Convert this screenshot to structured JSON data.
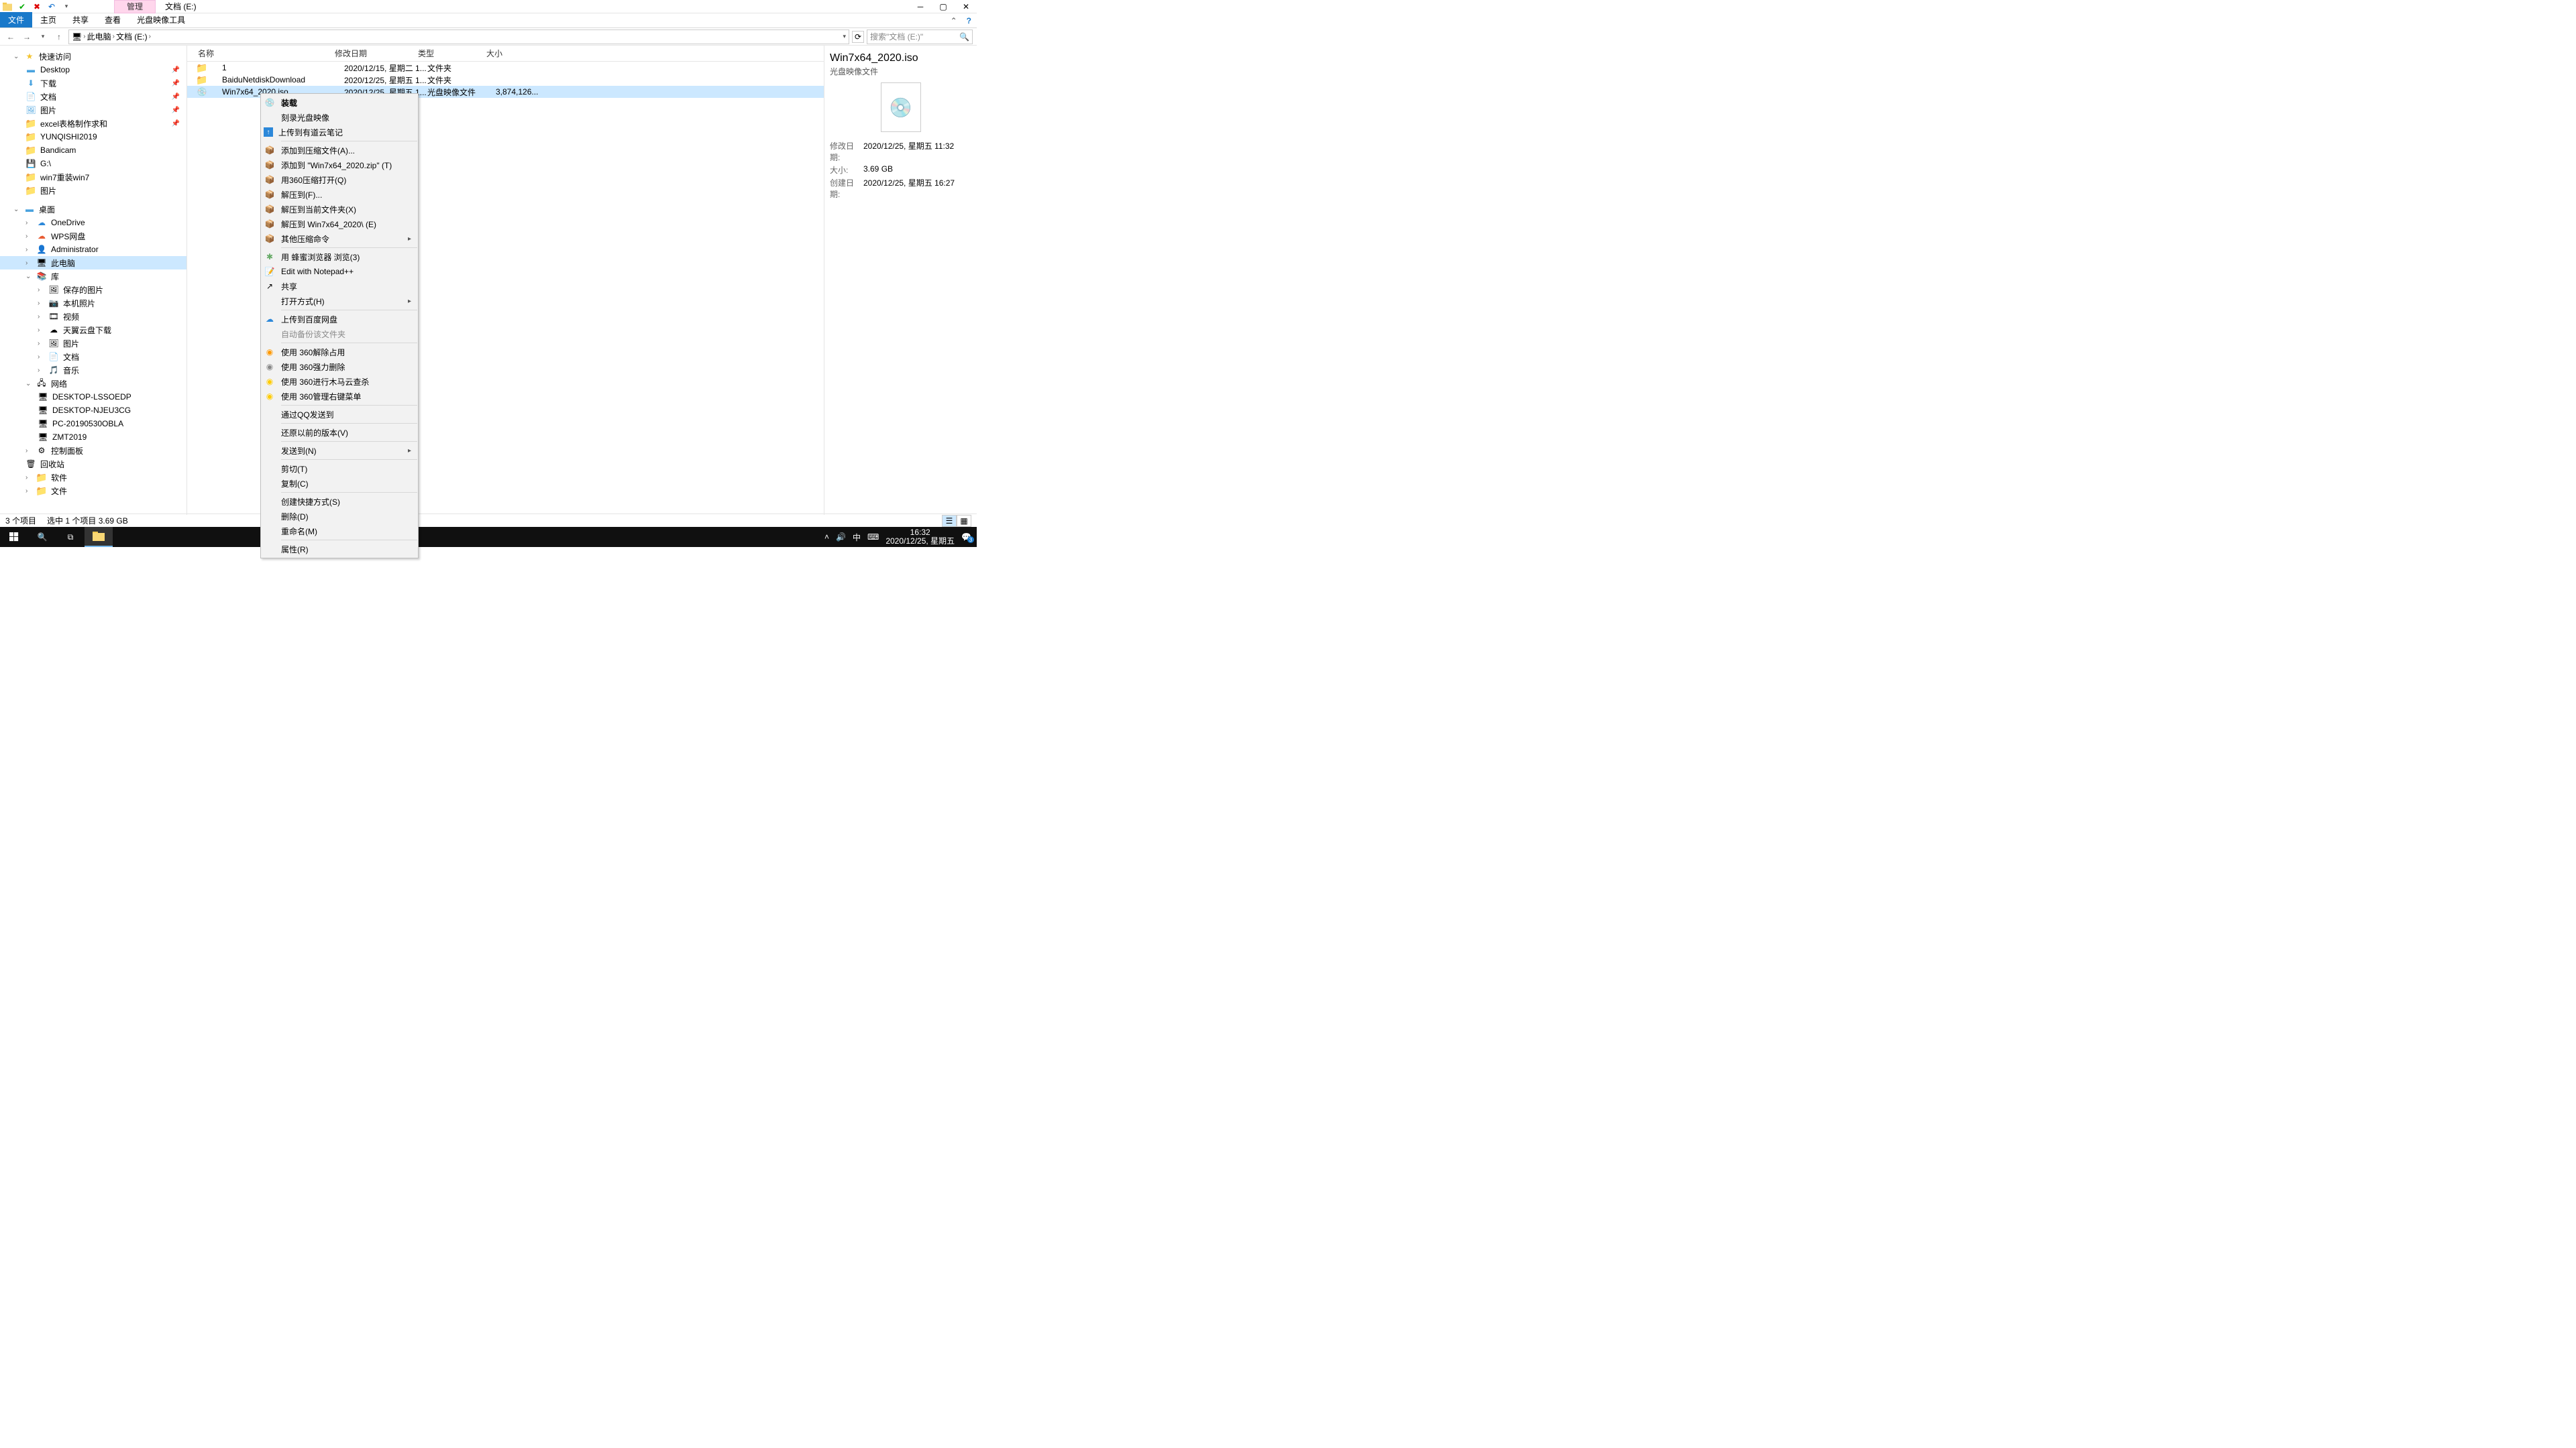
{
  "title_tab_manage": "管理",
  "title_tab_path": "文档 (E:)",
  "ribbon": {
    "file": "文件",
    "home": "主页",
    "share": "共享",
    "view": "查看",
    "tool": "光盘映像工具"
  },
  "breadcrumb": {
    "pc": "此电脑",
    "drive": "文档 (E:)"
  },
  "search_placeholder": "搜索\"文档 (E:)\"",
  "sidebar": {
    "quick": "快速访问",
    "items_qa": [
      "Desktop",
      "下载",
      "文档",
      "图片",
      "excel表格制作求和",
      "YUNQISHI2019",
      "Bandicam",
      "G:\\",
      "win7重装win7",
      "图片"
    ],
    "desktop": "桌面",
    "items_dt": [
      "OneDrive",
      "WPS网盘",
      "Administrator",
      "此电脑",
      "库"
    ],
    "items_lib": [
      "保存的图片",
      "本机照片",
      "视频",
      "天翼云盘下载",
      "图片",
      "文档",
      "音乐"
    ],
    "network": "网络",
    "items_net": [
      "DESKTOP-LSSOEDP",
      "DESKTOP-NJEU3CG",
      "PC-20190530OBLA",
      "ZMT2019"
    ],
    "items_misc": [
      "控制面板",
      "回收站",
      "软件",
      "文件"
    ]
  },
  "cols": {
    "name": "名称",
    "date": "修改日期",
    "type": "类型",
    "size": "大小"
  },
  "rows": [
    {
      "name": "1",
      "date": "2020/12/15, 星期二 1...",
      "type": "文件夹",
      "size": ""
    },
    {
      "name": "BaiduNetdiskDownload",
      "date": "2020/12/25, 星期五 1...",
      "type": "文件夹",
      "size": ""
    },
    {
      "name": "Win7x64_2020.iso",
      "date": "2020/12/25, 星期五 1...",
      "type": "光盘映像文件",
      "size": "3,874,126..."
    }
  ],
  "ctx": {
    "mount": "装载",
    "burn": "刻录光盘映像",
    "youdao": "上传到有道云笔记",
    "add_archive": "添加到压缩文件(A)...",
    "add_zip": "添加到 \"Win7x64_2020.zip\" (T)",
    "open_360zip": "用360压缩打开(Q)",
    "extract_to": "解压到(F)...",
    "extract_here": "解压到当前文件夹(X)",
    "extract_named": "解压到 Win7x64_2020\\ (E)",
    "other_zip": "其他压缩命令",
    "bee": "用 蜂蜜浏览器 浏览(3)",
    "npp": "Edit with Notepad++",
    "share": "共享",
    "openwith": "打开方式(H)",
    "baidu": "上传到百度网盘",
    "autobak": "自动备份该文件夹",
    "s360_unlock": "使用 360解除占用",
    "s360_delete": "使用 360强力删除",
    "s360_scan": "使用 360进行木马云查杀",
    "s360_menu": "使用 360管理右键菜单",
    "qq": "通过QQ发送到",
    "restore": "还原以前的版本(V)",
    "sendto": "发送到(N)",
    "cut": "剪切(T)",
    "copy": "复制(C)",
    "shortcut": "创建快捷方式(S)",
    "delete": "删除(D)",
    "rename": "重命名(M)",
    "props": "属性(R)"
  },
  "details": {
    "title": "Win7x64_2020.iso",
    "sub": "光盘映像文件",
    "mod_lbl": "修改日期:",
    "mod_val": "2020/12/25, 星期五 11:32",
    "size_lbl": "大小:",
    "size_val": "3.69 GB",
    "create_lbl": "创建日期:",
    "create_val": "2020/12/25, 星期五 16:27"
  },
  "status": {
    "count": "3 个项目",
    "sel": "选中 1 个项目  3.69 GB"
  },
  "taskbar": {
    "ime": "中",
    "time": "16:32",
    "date": "2020/12/25, 星期五",
    "badge": "3"
  }
}
